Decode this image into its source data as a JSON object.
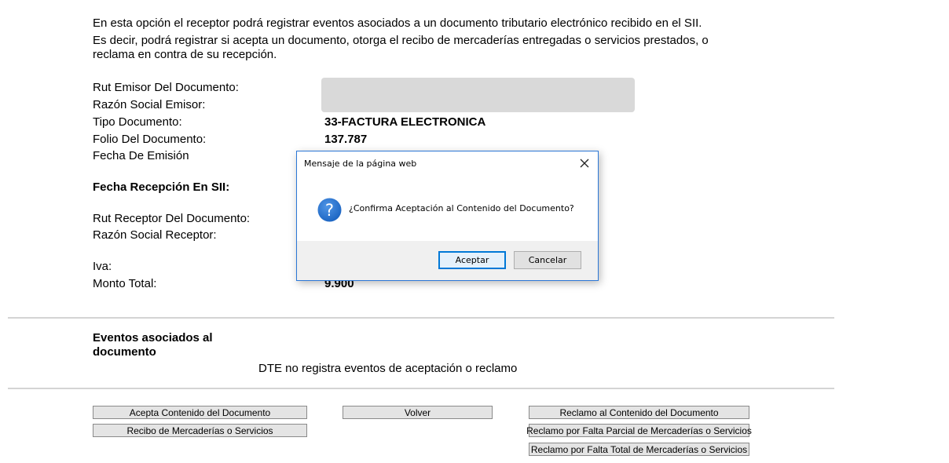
{
  "intro": {
    "line1": "En esta opción el receptor podrá registrar eventos asociados a un documento tributario electrónico recibido en el SII.",
    "line2": "Es decir, podrá registrar si acepta un documento, otorga el recibo de mercaderías entregadas o servicios prestados, o reclama en contra de su recepción."
  },
  "fields": {
    "rut_emisor_label": "Rut Emisor Del Documento:",
    "razon_social_emisor_label": "Razón Social Emisor:",
    "tipo_documento_label": "Tipo Documento:",
    "tipo_documento_value": "33-FACTURA ELECTRONICA",
    "folio_label": "Folio Del Documento:",
    "folio_value": "137.787",
    "fecha_emision_label": "Fecha De Emisión",
    "fecha_recepcion_label": "Fecha Recepción En SII:",
    "rut_receptor_label": "Rut Receptor Del Documento:",
    "razon_social_receptor_label": "Razón Social Receptor:",
    "iva_label": "Iva:",
    "monto_total_label": "Monto Total:",
    "monto_total_value": "9.900"
  },
  "events": {
    "heading": "Eventos asociados al documento",
    "empty_message": "DTE no registra eventos de aceptación o reclamo"
  },
  "actions": {
    "acepta_contenido": "Acepta Contenido del Documento",
    "recibo_mercaderias": "Recibo de Mercaderías o Servicios",
    "volver": "Volver",
    "reclamo_contenido": "Reclamo al Contenido del Documento",
    "reclamo_falta_parcial": "Reclamo por Falta Parcial de Mercaderías o Servicios",
    "reclamo_falta_total": "Reclamo por Falta Total de Mercaderías o Servicios"
  },
  "dialog": {
    "title": "Mensaje de la página web",
    "message": "¿Confirma Aceptación al Contenido del Documento?",
    "ok_label": "Aceptar",
    "cancel_label": "Cancelar",
    "icon": "question-icon",
    "close_icon": "close-icon"
  },
  "colors": {
    "dialog_border": "#2b77d6",
    "question_icon": "#1a63c1",
    "redaction": "#d9d9d9"
  }
}
